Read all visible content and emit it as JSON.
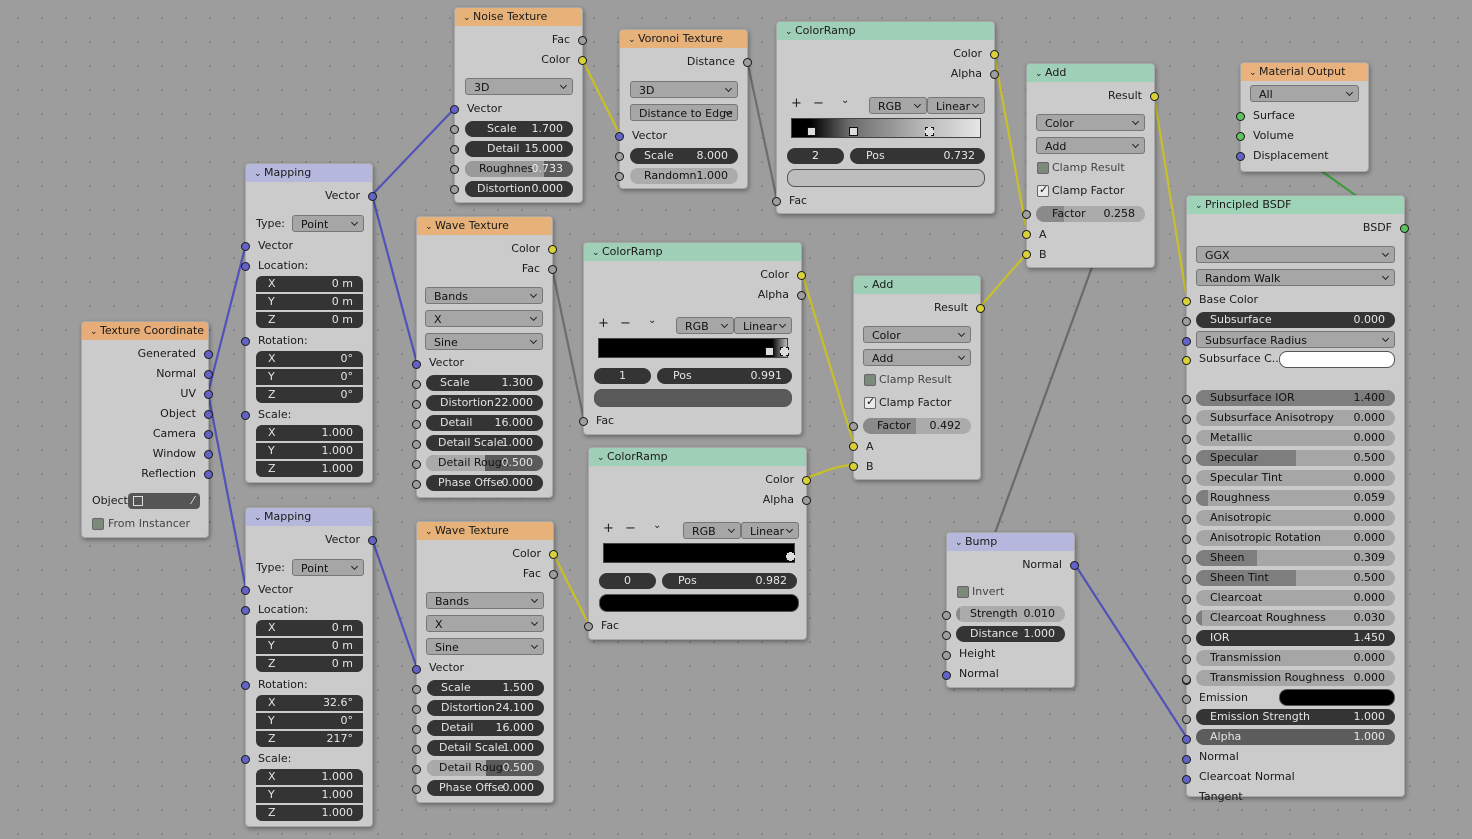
{
  "tex_coord": {
    "title": "Texture Coordinate",
    "outputs": [
      "Generated",
      "Normal",
      "UV",
      "Object",
      "Camera",
      "Window",
      "Reflection"
    ],
    "object_label": "Object:",
    "from_instancer": "From Instancer"
  },
  "mapping1": {
    "title": "Mapping",
    "output": "Vector",
    "type_label": "Type:",
    "type_value": "Point",
    "vector_label": "Vector",
    "location_label": "Location:",
    "location": [
      "0 m",
      "0 m",
      "0 m"
    ],
    "rotation_label": "Rotation:",
    "rotation": [
      "0°",
      "0°",
      "0°"
    ],
    "scale_label": "Scale:",
    "scale": [
      "1.000",
      "1.000",
      "1.000"
    ]
  },
  "mapping2": {
    "title": "Mapping",
    "output": "Vector",
    "type_label": "Type:",
    "type_value": "Point",
    "vector_label": "Vector",
    "location_label": "Location:",
    "location": [
      "0 m",
      "0 m",
      "0 m"
    ],
    "rotation_label": "Rotation:",
    "rotation": [
      "32.6°",
      "0°",
      "217°"
    ],
    "scale_label": "Scale:",
    "scale": [
      "1.000",
      "1.000",
      "1.000"
    ]
  },
  "axes": [
    "X",
    "Y",
    "Z"
  ],
  "noise": {
    "title": "Noise Texture",
    "outputs": [
      "Fac",
      "Color"
    ],
    "dimension": "3D",
    "vector_label": "Vector",
    "params": [
      {
        "l": "Scale",
        "v": "1.700"
      },
      {
        "l": "Detail",
        "v": "15.000"
      },
      {
        "l": "Roughnes",
        "v": "0.733"
      },
      {
        "l": "Distortion",
        "v": "0.000"
      }
    ]
  },
  "voronoi": {
    "title": "Voronoi Texture",
    "output": "Distance",
    "dimension": "3D",
    "feature": "Distance to Edge",
    "vector_label": "Vector",
    "params": [
      {
        "l": "Scale",
        "v": "8.000"
      },
      {
        "l": "Randomn",
        "v": "1.000"
      }
    ]
  },
  "ramp1": {
    "title": "ColorRamp",
    "outputs": [
      "Color",
      "Alpha"
    ],
    "mode": "RGB",
    "interp": "Linear",
    "index": "2",
    "pos_label": "Pos",
    "pos": "0.732",
    "fac": "Fac"
  },
  "ramp2": {
    "title": "ColorRamp",
    "outputs": [
      "Color",
      "Alpha"
    ],
    "mode": "RGB",
    "interp": "Linear",
    "index": "1",
    "pos_label": "Pos",
    "pos": "0.991",
    "fac": "Fac"
  },
  "ramp3": {
    "title": "ColorRamp",
    "outputs": [
      "Color",
      "Alpha"
    ],
    "mode": "RGB",
    "interp": "Linear",
    "index": "0",
    "pos_label": "Pos",
    "pos": "0.982",
    "fac": "Fac"
  },
  "wave1": {
    "title": "Wave Texture",
    "outputs": [
      "Color",
      "Fac"
    ],
    "type": "Bands",
    "axis": "X",
    "profile": "Sine",
    "vector_label": "Vector",
    "params": [
      {
        "l": "Scale",
        "v": "1.300"
      },
      {
        "l": "Distortion",
        "v": "22.000"
      },
      {
        "l": "Detail",
        "v": "16.000"
      },
      {
        "l": "Detail Scale",
        "v": "1.000"
      },
      {
        "l": "Detail Rough",
        "v": "0.500"
      },
      {
        "l": "Phase Offse",
        "v": "0.000"
      }
    ]
  },
  "wave2": {
    "title": "Wave Texture",
    "outputs": [
      "Color",
      "Fac"
    ],
    "type": "Bands",
    "axis": "X",
    "profile": "Sine",
    "vector_label": "Vector",
    "params": [
      {
        "l": "Scale",
        "v": "1.500"
      },
      {
        "l": "Distortion",
        "v": "24.100"
      },
      {
        "l": "Detail",
        "v": "16.000"
      },
      {
        "l": "Detail Scale",
        "v": "1.000"
      },
      {
        "l": "Detail Rough",
        "v": "0.500"
      },
      {
        "l": "Phase Offse",
        "v": "0.000"
      }
    ]
  },
  "add1": {
    "title": "Add",
    "output": "Result",
    "type": "Color",
    "op": "Add",
    "clamp_result": "Clamp Result",
    "clamp_factor": "Clamp Factor",
    "factor_label": "Factor",
    "factor": "0.492",
    "in_a": "A",
    "in_b": "B"
  },
  "add2": {
    "title": "Add",
    "output": "Result",
    "type": "Color",
    "op": "Add",
    "clamp_result": "Clamp Result",
    "clamp_factor": "Clamp Factor",
    "factor_label": "Factor",
    "factor": "0.258",
    "in_a": "A",
    "in_b": "B"
  },
  "bump": {
    "title": "Bump",
    "output": "Normal",
    "invert": "Invert",
    "params": [
      {
        "l": "Strength",
        "v": "0.010"
      },
      {
        "l": "Distance",
        "v": "1.000"
      }
    ],
    "inputs": [
      "Height",
      "Normal"
    ]
  },
  "matout": {
    "title": "Material Output",
    "target": "All",
    "inputs": [
      "Surface",
      "Volume",
      "Displacement"
    ]
  },
  "bsdf": {
    "title": "Principled BSDF",
    "output": "BSDF",
    "distribution": "GGX",
    "sss_method": "Random Walk",
    "base_color": "Base Color",
    "subsurface": {
      "l": "Subsurface",
      "v": "0.000"
    },
    "subsurface_radius": "Subsurface Radius",
    "subsurface_color": "Subsurface C...",
    "params": [
      {
        "l": "Subsurface IOR",
        "v": "1.400"
      },
      {
        "l": "Subsurface Anisotropy",
        "v": "0.000"
      },
      {
        "l": "Metallic",
        "v": "0.000"
      },
      {
        "l": "Specular",
        "v": "0.500"
      },
      {
        "l": "Specular Tint",
        "v": "0.000"
      },
      {
        "l": "Roughness",
        "v": "0.059"
      },
      {
        "l": "Anisotropic",
        "v": "0.000"
      },
      {
        "l": "Anisotropic Rotation",
        "v": "0.000"
      },
      {
        "l": "Sheen",
        "v": "0.309"
      },
      {
        "l": "Sheen Tint",
        "v": "0.500"
      },
      {
        "l": "Clearcoat",
        "v": "0.000"
      },
      {
        "l": "Clearcoat Roughness",
        "v": "0.030"
      },
      {
        "l": "IOR",
        "v": "1.450"
      },
      {
        "l": "Transmission",
        "v": "0.000"
      },
      {
        "l": "Transmission Roughness",
        "v": "0.000"
      }
    ],
    "emission": "Emission",
    "emission_strength": {
      "l": "Emission Strength",
      "v": "1.000"
    },
    "alpha": {
      "l": "Alpha",
      "v": "1.000"
    },
    "inputs": [
      "Normal",
      "Clearcoat Normal",
      "Tangent"
    ]
  },
  "colors": {
    "yellow": "#d8d13a",
    "blue": "#6363c7",
    "grey": "#9e9e9e",
    "green": "#5fc25f",
    "texture_header": "#e7b27a",
    "converter_header": "#9fcfb7"
  }
}
